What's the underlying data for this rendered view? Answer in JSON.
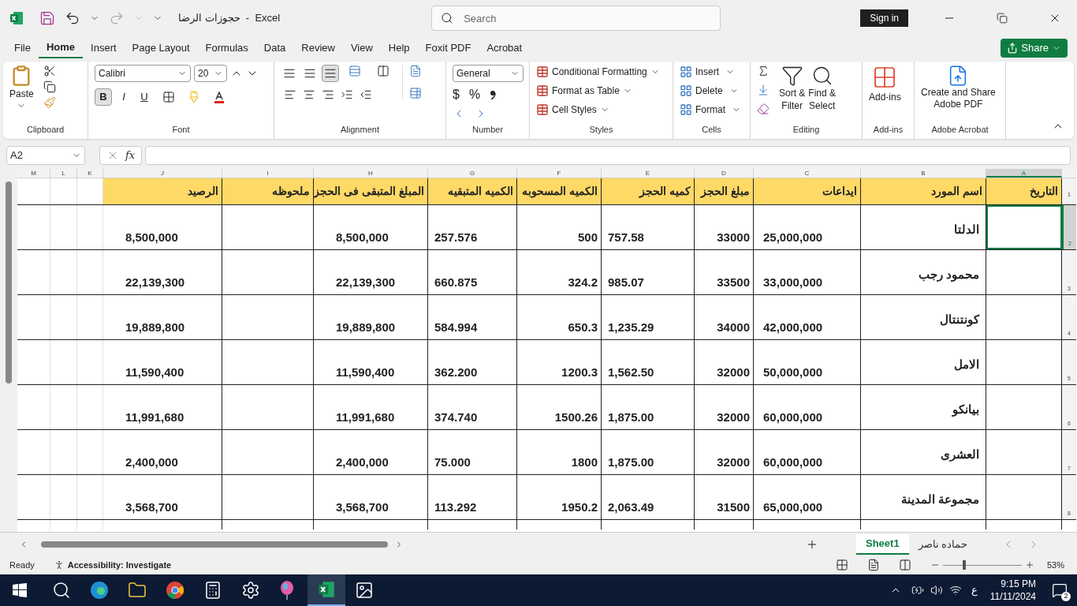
{
  "window": {
    "title": "حجوزات الرضا  -  Excel",
    "search_placeholder": "Search",
    "sign_in": "Sign in"
  },
  "menu_tabs": [
    {
      "label": "File",
      "selected": false
    },
    {
      "label": "Home",
      "selected": true
    },
    {
      "label": "Insert",
      "selected": false
    },
    {
      "label": "Page Layout",
      "selected": false
    },
    {
      "label": "Formulas",
      "selected": false
    },
    {
      "label": "Data",
      "selected": false
    },
    {
      "label": "Review",
      "selected": false
    },
    {
      "label": "View",
      "selected": false
    },
    {
      "label": "Help",
      "selected": false
    },
    {
      "label": "Foxit PDF",
      "selected": false
    },
    {
      "label": "Acrobat",
      "selected": false
    }
  ],
  "share": "Share",
  "ribbon": {
    "clipboard": {
      "label": "Clipboard",
      "paste": "Paste"
    },
    "font": {
      "label": "Font",
      "name": "Calibri",
      "size": "20",
      "styles": [
        {
          "label": "B",
          "selected": true
        },
        {
          "label": "I",
          "selected": false
        },
        {
          "label": "U",
          "selected": false
        }
      ]
    },
    "alignment": {
      "label": "Alignment",
      "vertical": [
        {
          "selected": false
        },
        {
          "selected": false
        },
        {
          "selected": true
        }
      ]
    },
    "number": {
      "label": "Number",
      "format": "General",
      "currency": "$",
      "percent": "%"
    },
    "styles": {
      "label": "Styles",
      "items": [
        "Conditional Formatting",
        "Format as Table",
        "Cell Styles"
      ]
    },
    "cells": {
      "label": "Cells",
      "items": [
        "Insert",
        "Delete",
        "Format"
      ]
    },
    "editing": {
      "label": "Editing",
      "sort": [
        "Sort &",
        "Filter"
      ],
      "find": [
        "Find &",
        "Select"
      ]
    },
    "addins": {
      "label": "Add-ins",
      "button": "Add-ins"
    },
    "acrobat": {
      "label": "Adobe Acrobat",
      "button": [
        "Create and Share",
        "Adobe PDF"
      ]
    }
  },
  "formula_bar": {
    "name_box": "A2",
    "function": "fx"
  },
  "sheet": {
    "columns": [
      {
        "label": "M",
        "selected": false
      },
      {
        "label": "L",
        "selected": false
      },
      {
        "label": "K",
        "selected": false
      },
      {
        "label": "J",
        "selected": false,
        "heading": "الرصيد"
      },
      {
        "label": "I",
        "selected": false,
        "heading": "ملحوظه"
      },
      {
        "label": "H",
        "selected": false,
        "heading": "المبلغ المتبقى فى الحجز"
      },
      {
        "label": "G",
        "selected": false,
        "heading": "الكميه المتبقيه"
      },
      {
        "label": "F",
        "selected": false,
        "heading": "الكميه المسحوبه"
      },
      {
        "label": "E",
        "selected": false,
        "heading": "كميه الحجز"
      },
      {
        "label": "D",
        "selected": false,
        "heading": "مبلغ الحجز"
      },
      {
        "label": "C",
        "selected": false,
        "heading": "ايداعات"
      },
      {
        "label": "B",
        "selected": false,
        "heading": "اسم المورد"
      },
      {
        "label": "A",
        "selected": true,
        "heading": "التاريخ"
      }
    ],
    "header_row": {
      "number": "1"
    },
    "rows": [
      {
        "number": "2",
        "selected": true,
        "cells": [
          "",
          "",
          "",
          "8,500,000",
          "",
          "8,500,000",
          "257.576",
          "500",
          "757.58",
          "33000",
          "25,000,000",
          "الدلتا",
          ""
        ]
      },
      {
        "number": "3",
        "selected": false,
        "cells": [
          "",
          "",
          "",
          "22,139,300",
          "",
          "22,139,300",
          "660.875",
          "324.2",
          "985.07",
          "33500",
          "33,000,000",
          "محمود رجب",
          ""
        ]
      },
      {
        "number": "4",
        "selected": false,
        "cells": [
          "",
          "",
          "",
          "19,889,800",
          "",
          "19,889,800",
          "584.994",
          "650.3",
          "1,235.29",
          "34000",
          "42,000,000",
          "كونتنتال",
          ""
        ]
      },
      {
        "number": "5",
        "selected": false,
        "cells": [
          "",
          "",
          "",
          "11,590,400",
          "",
          "11,590,400",
          "362.200",
          "1200.3",
          "1,562.50",
          "32000",
          "50,000,000",
          "الامل",
          ""
        ]
      },
      {
        "number": "6",
        "selected": false,
        "cells": [
          "",
          "",
          "",
          "11,991,680",
          "",
          "11,991,680",
          "374.740",
          "1500.26",
          "1,875.00",
          "32000",
          "60,000,000",
          "بيانكو",
          ""
        ]
      },
      {
        "number": "7",
        "selected": false,
        "cells": [
          "",
          "",
          "",
          "2,400,000",
          "",
          "2,400,000",
          "75.000",
          "1800",
          "1,875.00",
          "32000",
          "60,000,000",
          "العشرى",
          ""
        ]
      },
      {
        "number": "8",
        "selected": false,
        "cells": [
          "",
          "",
          "",
          "3,568,700",
          "",
          "3,568,700",
          "113.292",
          "1950.2",
          "2,063.49",
          "31500",
          "65,000,000",
          "مجموعة المدينة",
          ""
        ]
      }
    ]
  },
  "sheet_tabs": [
    {
      "label": "Sheet1",
      "selected": true
    },
    {
      "label": "حماده ناصر",
      "selected": false
    }
  ],
  "status_bar": {
    "mode": "Ready",
    "accessibility": "Accessibility: Investigate",
    "zoom": "53%",
    "zoom_level": {
      "level": 0.25
    }
  },
  "taskbar": {
    "language": "ع",
    "time": "9:15 PM",
    "date": "11/11/2024",
    "notifications": "2"
  }
}
